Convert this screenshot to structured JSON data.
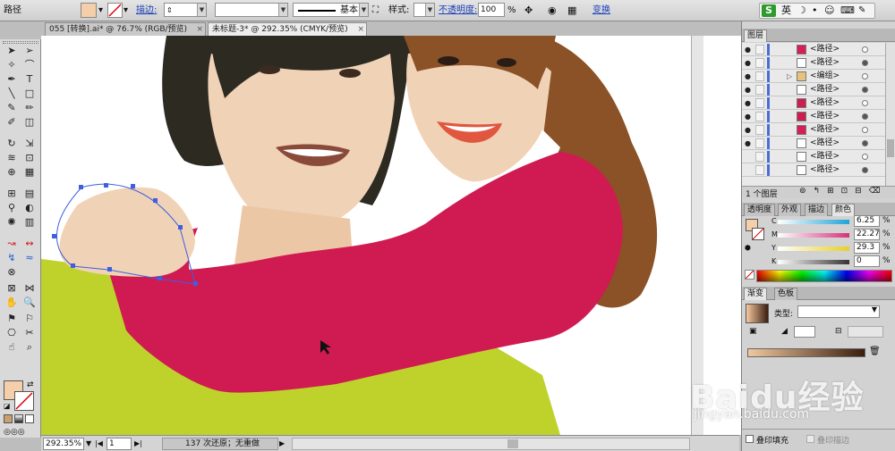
{
  "control_bar": {
    "selection_label": "路径",
    "stroke_label": "描边:",
    "stroke_style_label": "基本",
    "style_label": "样式:",
    "opacity_label": "不透明度:",
    "opacity_value": "100",
    "opacity_unit": "%",
    "transform_label": "变换",
    "fill_color": "#f5cfa9"
  },
  "ime": {
    "logo": "S",
    "lang": "英",
    "moon": "☽",
    "dot": "•",
    "smile": "☺",
    "keyboard": "⌨",
    "shirt": "👕",
    "wrench": "✎"
  },
  "tabs": [
    {
      "label": "055 [转换].ai* @ 76.7% (RGB/预览)",
      "close": "×"
    },
    {
      "label": "未标题-3* @ 292.35% (CMYK/预览)",
      "close": "×"
    }
  ],
  "status": {
    "zoom": "292.35%",
    "page": "1",
    "history_text": "137 次还原；无重做"
  },
  "layers_panel": {
    "title": "图层",
    "rows": [
      {
        "name": "<路径>",
        "swatch": "#d51f55",
        "has_arrow": false,
        "filled_circle": false
      },
      {
        "name": "<路径>",
        "swatch": "#ffffff",
        "has_arrow": false,
        "filled_circle": true
      },
      {
        "name": "<编组>",
        "swatch": "#e8c27d",
        "has_arrow": true,
        "filled_circle": false
      },
      {
        "name": "<路径>",
        "swatch": "#ffffff",
        "has_arrow": false,
        "filled_circle": true
      },
      {
        "name": "<路径>",
        "swatch": "#cc1f4f",
        "has_arrow": false,
        "filled_circle": false
      },
      {
        "name": "<路径>",
        "swatch": "#cc1f4f",
        "has_arrow": false,
        "filled_circle": true
      },
      {
        "name": "<路径>",
        "swatch": "#d51f55",
        "has_arrow": false,
        "filled_circle": false
      },
      {
        "name": "<路径>",
        "swatch": "#ffffff",
        "has_arrow": false,
        "filled_circle": true
      },
      {
        "name": "<路径>",
        "swatch": "#ffffff",
        "has_arrow": false,
        "filled_circle": false
      },
      {
        "name": "<路径>",
        "swatch": "#ffffff",
        "has_arrow": false,
        "filled_circle": true
      }
    ],
    "footer_count": "1 个图层"
  },
  "color_panel": {
    "tabs": [
      "透明度",
      "外观",
      "描边",
      "颜色"
    ],
    "channels": [
      {
        "label": "C",
        "value": "6.25",
        "unit": "%",
        "color": "#1fa3d9"
      },
      {
        "label": "M",
        "value": "22.27",
        "unit": "%",
        "color": "#d6317a"
      },
      {
        "label": "Y",
        "value": "29.3",
        "unit": "%",
        "color": "#e7cf2c"
      },
      {
        "label": "K",
        "value": "0",
        "unit": "%",
        "color": "#333333"
      }
    ]
  },
  "gradient_panel": {
    "tabs": [
      "渐变",
      "色板"
    ],
    "type_label": "类型:"
  },
  "watermark": {
    "brand": "Baidu经验",
    "url": "jingyan.baidu.com"
  },
  "bottom_panel": {
    "overprint_fill": "叠印填充",
    "overprint_stroke": "叠印描边"
  },
  "colors": {
    "shirt_red": "#d01a52",
    "shirt_green": "#bfd22c",
    "skin": "#f0d2b6",
    "hair_dark": "#2d2a22",
    "hair_brown": "#8a5226",
    "selection_blue": "#3e5fe0"
  }
}
